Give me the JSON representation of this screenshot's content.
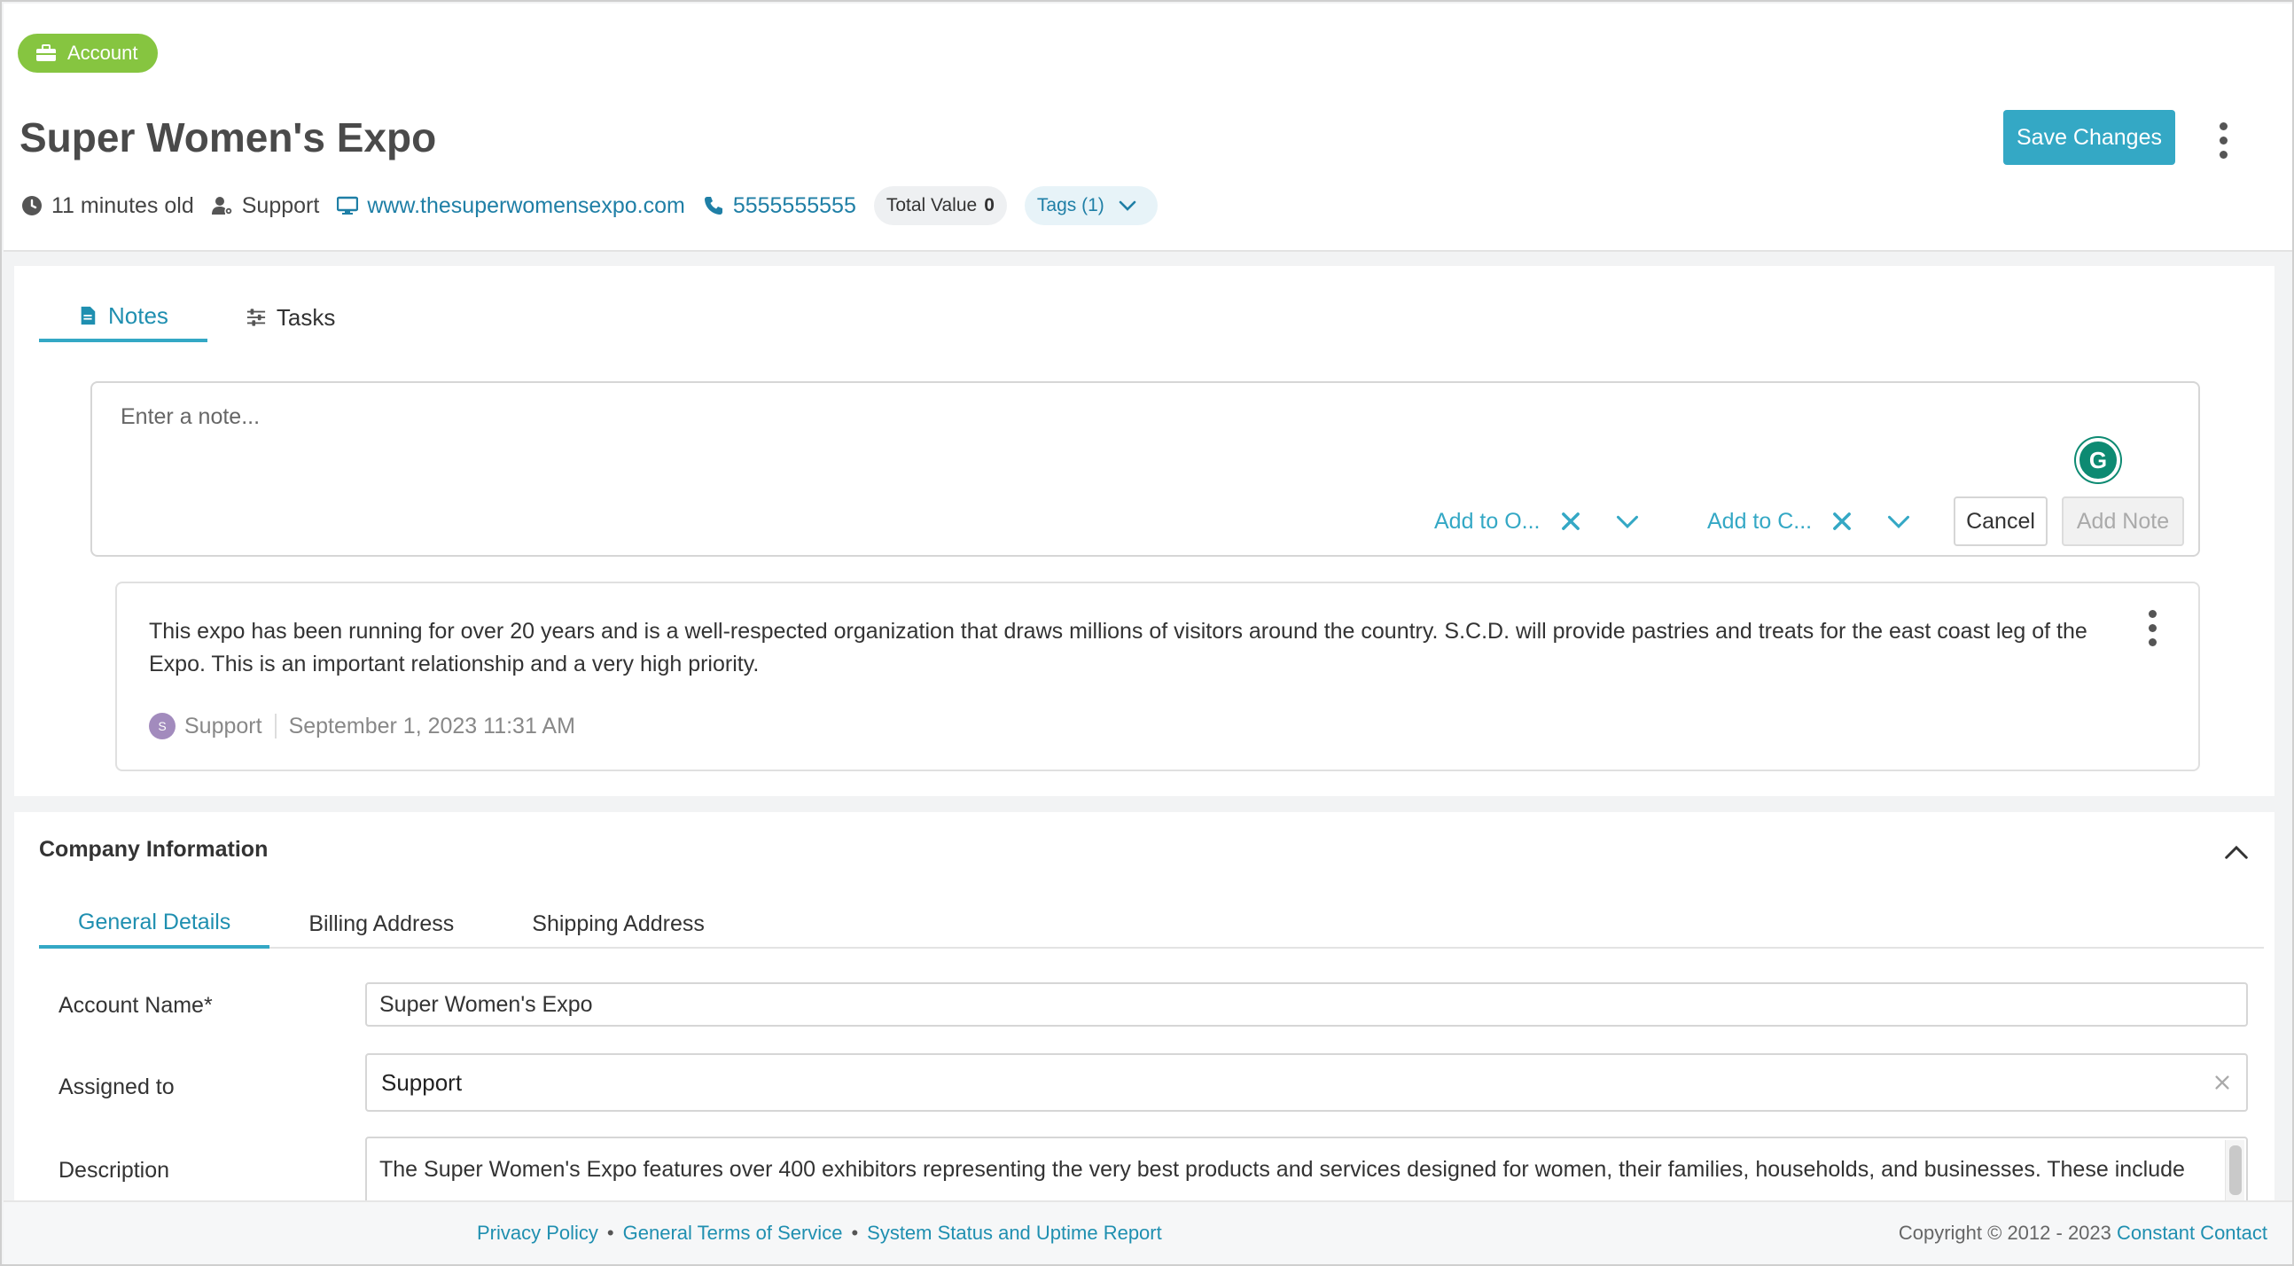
{
  "header": {
    "badge_label": "Account",
    "title": "Super Women's Expo",
    "save_label": "Save Changes",
    "age": "11 minutes old",
    "owner": "Support",
    "website": "www.thesuperwomensexpo.com",
    "phone": "5555555555",
    "total_value_label": "Total Value",
    "total_value": "0",
    "tags_label": "Tags (1)"
  },
  "tabs": [
    {
      "label": "Notes",
      "icon": "document-icon",
      "active": true
    },
    {
      "label": "Tasks",
      "icon": "sliders-icon",
      "active": false
    }
  ],
  "note_editor": {
    "placeholder": "Enter a note...",
    "grammarly_glyph": "G",
    "add_to_opportunity": "Add to O...",
    "add_to_contact": "Add to C...",
    "cancel_label": "Cancel",
    "add_note_label": "Add Note"
  },
  "note": {
    "text": "This expo has been running for over 20 years and is a well-respected organization that draws millions of visitors around the country. S.C.D. will provide pastries and treats for the east coast leg of the Expo. This is an important relationship and a very high priority.",
    "avatar_initial": "S",
    "author": "Support",
    "timestamp": "September 1, 2023 11:31 AM"
  },
  "company": {
    "section_title": "Company Information",
    "subtabs": [
      "General Details",
      "Billing Address",
      "Shipping Address"
    ],
    "account_name_label": "Account Name*",
    "account_name_value": "Super Women's Expo",
    "assigned_label": "Assigned to",
    "assigned_value": "Support",
    "description_label": "Description",
    "description_value": "The Super Women's Expo features over 400 exhibitors representing the very best products and services designed for women, their families, households, and businesses. These include"
  },
  "footer": {
    "privacy": "Privacy Policy",
    "terms": "General Terms of Service",
    "status": "System Status and Uptime Report",
    "bullet": "•",
    "copyright": "Copyright © 2012 - 2023",
    "company": "Constant Contact"
  },
  "colors": {
    "accent": "#34a8c5",
    "badge_green": "#86c540",
    "link": "#1f7fa6",
    "grammarly": "#0d8a72"
  }
}
